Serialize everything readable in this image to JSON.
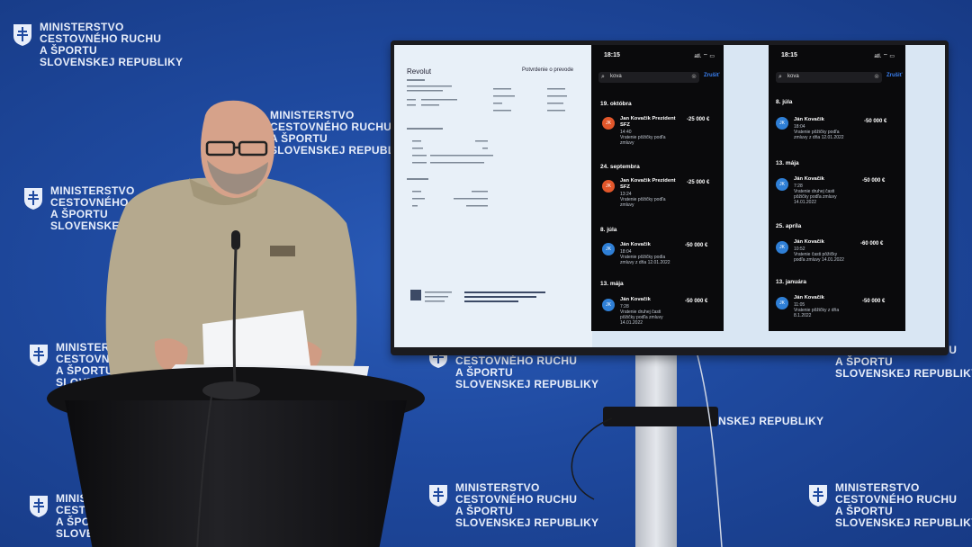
{
  "logo": {
    "line1": "MINISTERSTVO",
    "line2": "CESTOVNÉHO RUCHU",
    "line3": "A ŠPORTU",
    "line4": "SLOVENSKEJ REPUBLIKY"
  },
  "document": {
    "brand": "Revolut",
    "title": "Potvrdenie o prevode"
  },
  "phones": [
    {
      "time": "18:15",
      "signal": "atl. ⌔ ▭",
      "search": "kova",
      "cancel": "Zrušiť",
      "groups": [
        {
          "day": "19. októbra",
          "name": "Jan Kovačik Prezident SFZ",
          "time": "14:40",
          "desc": "Vratenie pôžičky podľa\nzmluvy",
          "amount": "-25 000 €",
          "initials": "JK",
          "orange": true
        },
        {
          "day": "24. septembra",
          "name": "Jan Kovačik Prezident SFZ",
          "time": "13:24",
          "desc": "Vratenie pôžičky podľa\nzmluvy",
          "amount": "-25 000 €",
          "initials": "JK",
          "orange": true
        },
        {
          "day": "8. júla",
          "name": "Ján Kovačik",
          "time": "18:04",
          "desc": "Vratenie pôžičky podla\nzmluvy z dňa 12.01.2022",
          "amount": "-50 000 €",
          "initials": "JK",
          "orange": false
        },
        {
          "day": "13. mája",
          "name": "Ján Kovačik",
          "time": "7:28",
          "desc": "Vratenie druhej časti\npôžičky podľa zmluvy\n14.01.2022",
          "amount": "-50 000 €",
          "initials": "JK",
          "orange": false
        }
      ]
    },
    {
      "time": "18:15",
      "signal": "atl. ⌔ ▭",
      "search": "kova",
      "cancel": "Zrušiť",
      "groups": [
        {
          "day": "8. júla",
          "name": "Ján Kovačik",
          "time": "18:04",
          "desc": "Vratenie pôžičky podľa\nzmluvy z dňa 12.01.2022",
          "amount": "-50 000 €",
          "initials": "JK",
          "orange": false
        },
        {
          "day": "13. mája",
          "name": "Ján Kovačik",
          "time": "7:28",
          "desc": "Vratenie druhej časti\npôžičky podľa zmluvy\n14.01.2022",
          "amount": "-50 000 €",
          "initials": "JK",
          "orange": false
        },
        {
          "day": "25. apríla",
          "name": "Ján Kovačik",
          "time": "10:52",
          "desc": "Vratenie časti pôžičky\npodľa zmluvy 14.01.2022",
          "amount": "-60 000 €",
          "initials": "JK",
          "orange": false
        },
        {
          "day": "13. januára",
          "name": "Ján Kovačik",
          "time": "11:05",
          "desc": "Vratenie pôžičky z dňa\n8.1.2022",
          "amount": "-50 000 €",
          "initials": "JK",
          "orange": false
        }
      ]
    }
  ]
}
